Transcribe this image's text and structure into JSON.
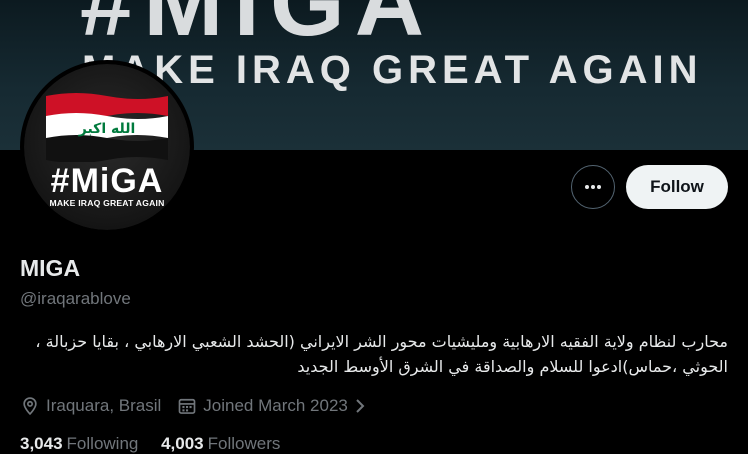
{
  "banner": {
    "headline": "#MiGA",
    "tagline": "MAKE IRAQ GREAT AGAIN"
  },
  "avatar": {
    "flag_text": "الله اكبر",
    "title": "#MiGA",
    "subtitle": "MAKE IRAQ GREAT AGAIN"
  },
  "actions": {
    "more_label": "•••",
    "follow_label": "Follow"
  },
  "profile": {
    "name": "MIGA",
    "handle": "@iraqarablove",
    "bio": "محارب لنظام ولاية الفقيه الارهابية ومليشيات محور الشر الايراني (الحشد الشعبي الارهابي ، بقايا حزبالة ، الحوثي ،حماس)ادعوا للسلام والصداقة في الشرق الأوسط الجديد",
    "location": "Iraquara, Brasil",
    "joined": "Joined March 2023"
  },
  "stats": {
    "following_count": "3,043",
    "following_label": "Following",
    "followers_count": "4,003",
    "followers_label": "Followers"
  },
  "colors": {
    "background": "#000000",
    "muted": "#71767b",
    "follow_bg": "#eff3f4",
    "flag_red": "#ce1126",
    "flag_green": "#007a3d"
  }
}
